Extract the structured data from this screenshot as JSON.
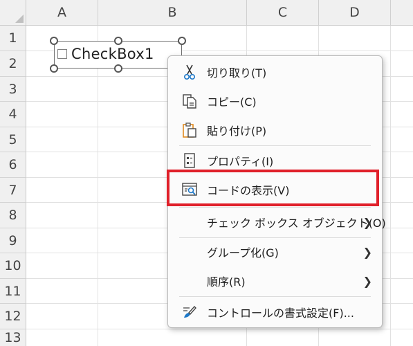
{
  "columns": [
    "A",
    "B",
    "C",
    "D"
  ],
  "rows": [
    "1",
    "2",
    "3",
    "4",
    "5",
    "6",
    "7",
    "8",
    "9",
    "10",
    "11",
    "12",
    "13"
  ],
  "checkbox": {
    "label": "CheckBox1"
  },
  "context_menu": {
    "items": [
      {
        "label": "切り取り(T)",
        "icon": "scissors-icon"
      },
      {
        "label": "コピー(C)",
        "icon": "copy-icon"
      },
      {
        "label": "貼り付け(P)",
        "icon": "paste-icon"
      },
      {
        "label": "プロパティ(I)",
        "icon": "properties-icon"
      },
      {
        "label": "コードの表示(V)",
        "icon": "view-code-icon"
      },
      {
        "label": "チェック ボックス オブジェクト(O)",
        "submenu": true
      },
      {
        "label": "グループ化(G)",
        "submenu": true
      },
      {
        "label": "順序(R)",
        "submenu": true
      },
      {
        "label": "コントロールの書式設定(F)...",
        "icon": "format-control-icon"
      }
    ],
    "highlight_color": "#e0202a"
  }
}
